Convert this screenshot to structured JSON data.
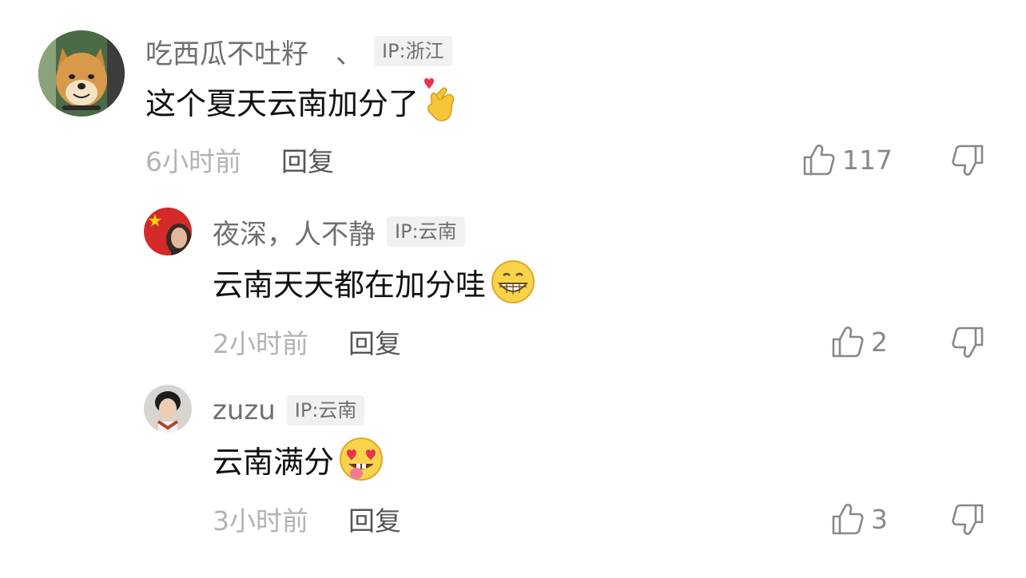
{
  "comments": [
    {
      "username": "吃西瓜不吐籽　、",
      "ip": "IP:浙江",
      "text": "这个夏天云南加分了",
      "emoji": "finger-heart-emoji",
      "time": "6小时前",
      "reply_label": "回复",
      "likes": "117",
      "avatar": "shiba-dog-avatar"
    },
    {
      "username": "夜深，人不静",
      "ip": "IP:云南",
      "text": "云南天天都在加分哇",
      "emoji": "grinning-emoji",
      "time": "2小时前",
      "reply_label": "回复",
      "likes": "2",
      "avatar": "flag-avatar"
    },
    {
      "username": "zuzu",
      "ip": "IP:云南",
      "text": "云南满分",
      "emoji": "heart-eyes-tongue-emoji",
      "time": "3小时前",
      "reply_label": "回复",
      "likes": "3",
      "avatar": "person-avatar"
    }
  ],
  "icons": {
    "like": "thumbs-up-icon",
    "dislike": "thumbs-down-icon"
  },
  "colors": {
    "username": "#6f6f6f",
    "text": "#111111",
    "time": "#b3b3b3",
    "ip_badge_bg": "#f1f1f1"
  }
}
